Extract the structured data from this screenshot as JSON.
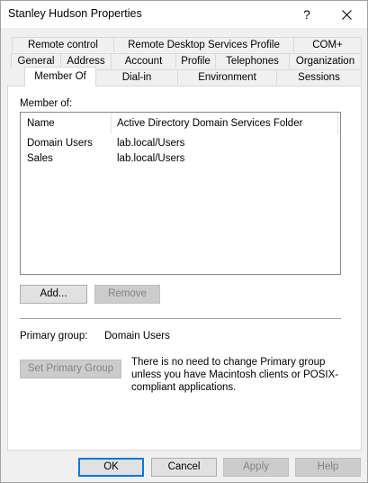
{
  "window": {
    "title": "Stanley Hudson Properties",
    "help_glyph": "?"
  },
  "tabs": {
    "row1": [
      "Remote control",
      "Remote Desktop Services Profile",
      "COM+"
    ],
    "row2": [
      "General",
      "Address",
      "Account",
      "Profile",
      "Telephones",
      "Organization"
    ],
    "row3": [
      "Member Of",
      "Dial-in",
      "Environment",
      "Sessions"
    ],
    "active": "Member Of"
  },
  "member_of": {
    "section_label": "Member of:",
    "columns": [
      "Name",
      "Active Directory Domain Services Folder"
    ],
    "rows": [
      [
        "Domain Users",
        "lab.local/Users"
      ],
      [
        "Sales",
        "lab.local/Users"
      ]
    ]
  },
  "buttons": {
    "add": "Add...",
    "remove": "Remove",
    "set_primary": "Set Primary Group",
    "ok": "OK",
    "cancel": "Cancel",
    "apply": "Apply",
    "help": "Help"
  },
  "primary_group": {
    "label": "Primary group:",
    "value": "Domain Users",
    "note": "There is no need to change Primary group unless you have Macintosh clients or POSIX-compliant applications."
  },
  "icons": {
    "close": "close-icon"
  }
}
